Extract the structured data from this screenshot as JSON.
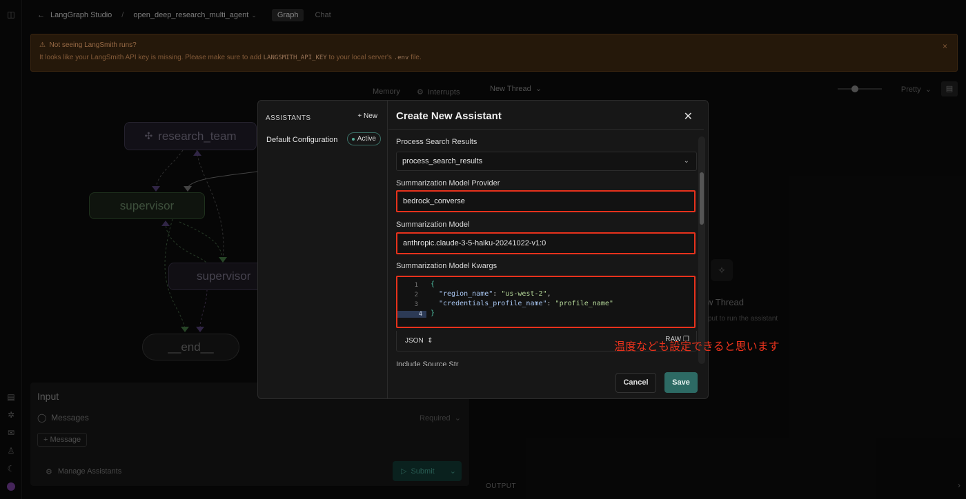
{
  "topbar": {
    "back_icon": "arrow-left-icon",
    "app_name": "LangGraph Studio",
    "separator": "/",
    "project": "open_deep_research_multi_agent",
    "tabs": [
      {
        "label": "Graph",
        "active": true
      },
      {
        "label": "Chat",
        "active": false
      }
    ]
  },
  "banner": {
    "title": "Not seeing LangSmith runs?",
    "msg_prefix": "It looks like your LangSmith API key is missing. Please make sure to add",
    "env_var": "LANGSMITH_API_KEY",
    "msg_middle": "to your local server's",
    "env_file": ".env",
    "msg_suffix": "file.",
    "close": "×"
  },
  "graph": {
    "toolbar": {
      "memory": "Memory",
      "interrupts": "Interrupts"
    },
    "nodes": {
      "research_team": "research_team",
      "supervisor": "supervisor",
      "supervisor_sub": "supervisor",
      "end": "__end__"
    }
  },
  "input_panel": {
    "title": "Input",
    "messages": "Messages",
    "required": "Required",
    "add_message": "+ Message",
    "manage_assistants": "Manage Assistants",
    "submit": "Submit"
  },
  "thread": {
    "new_thread": "New Thread",
    "pretty": "Pretty",
    "empty_title": "w Thread",
    "empty_sub": "put to run the assistant",
    "output": "OUTPUT"
  },
  "modal": {
    "assistants_header": "ASSISTANTS",
    "new_button": "+ New",
    "assistants": [
      {
        "name": "Default Configuration",
        "status": "Active"
      }
    ],
    "title": "Create New Assistant",
    "fields": [
      {
        "label": "Process Search Results",
        "value": "process_search_results"
      },
      {
        "label": "Summarization Model Provider",
        "value": "bedrock_converse"
      },
      {
        "label": "Summarization Model",
        "value": "anthropic.claude-3-5-haiku-20241022-v1:0"
      },
      {
        "label": "Summarization Model Kwargs"
      }
    ],
    "code": {
      "line_numbers": [
        "1",
        "2",
        "3",
        "4"
      ],
      "open_brace": "{",
      "close_brace": "}",
      "region_key": "\"region_name\"",
      "region_value": "\"us-west-2\"",
      "cred_key": "\"credentials_profile_name\"",
      "cred_value": "\"profile_name\"",
      "colon": ": ",
      "comma": ","
    },
    "format": "JSON",
    "raw": "RAW",
    "partial_label": "Include Source Str",
    "cancel": "Cancel",
    "save": "Save"
  },
  "annotation": "温度なども設定できると思います"
}
